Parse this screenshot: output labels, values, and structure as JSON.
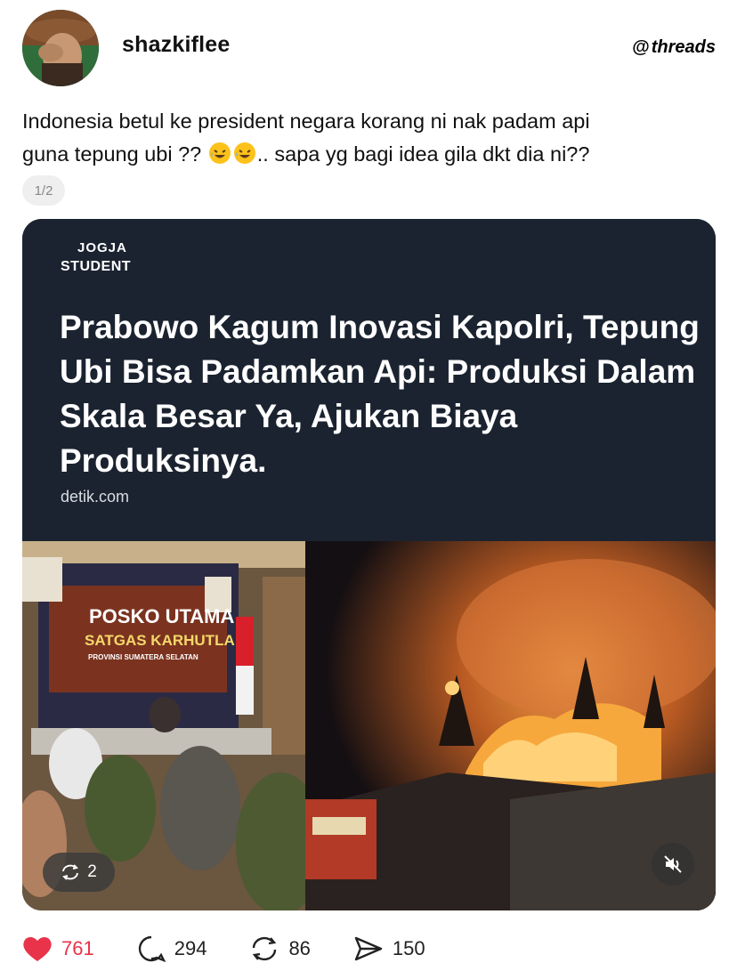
{
  "post": {
    "username": "shazkiflee",
    "brand": "threads",
    "caption_line1": "Indonesia betul ke president negara korang ni nak padam api",
    "caption_line2_a": "guna tepung ubi ?? ",
    "caption_line2_b": ".. sapa yg bagi idea gila dkt dia ni??",
    "pager": "1/2"
  },
  "card": {
    "logo_top": "JOGJA",
    "logo_bottom": "STUDENT",
    "headline": "Prabowo Kagum Inovasi Kapolri, Tepung Ubi Bisa Padamkan Api: Produksi Dalam Skala Besar Ya, Ajukan Biaya Produksinya.",
    "source": "detik.com",
    "banner_title": "POSKO UTAMA",
    "banner_sub": "SATGAS KARHUTLA",
    "banner_region": "PROVINSI SUMATERA SELATAN",
    "carousel_count": "2"
  },
  "actions": {
    "likes": "761",
    "comments": "294",
    "reposts": "86",
    "shares": "150"
  },
  "colors": {
    "like": "#e8334a",
    "card_bg": "#1b2330"
  }
}
